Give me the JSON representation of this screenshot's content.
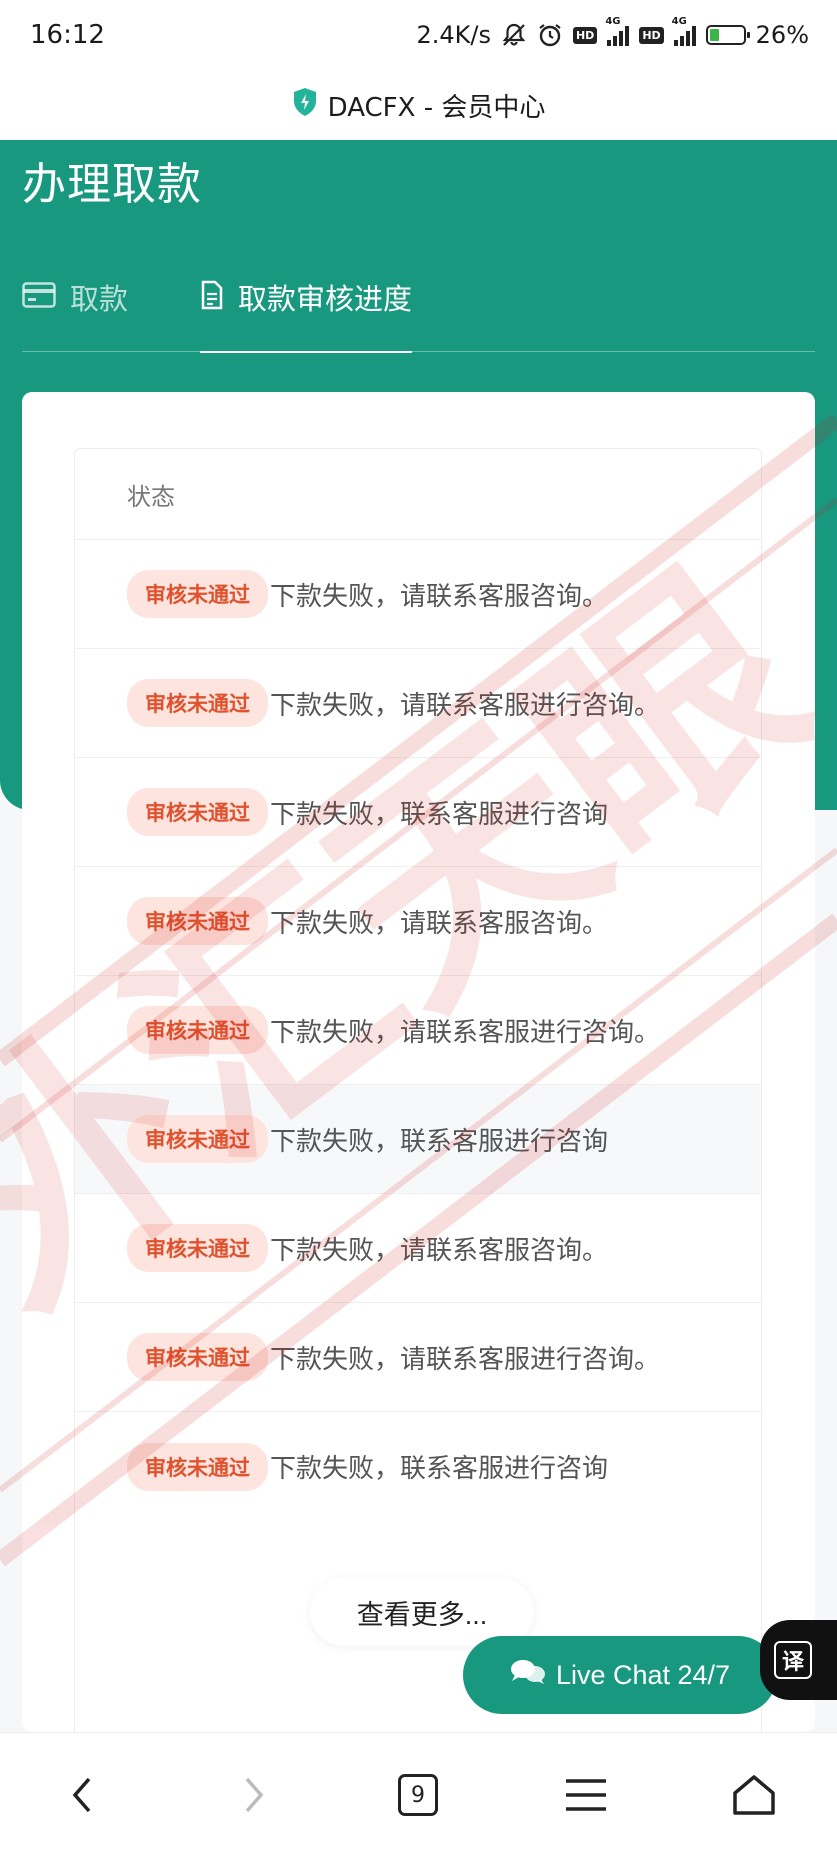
{
  "status_bar": {
    "time": "16:12",
    "net_speed": "2.4K/s",
    "hd": "HD",
    "network": "4G",
    "battery": "26%"
  },
  "url_bar": {
    "site_title": "DACFX - 会员中心"
  },
  "page": {
    "title": "办理取款"
  },
  "tabs": [
    {
      "label": "取款"
    },
    {
      "label": "取款审核进度"
    }
  ],
  "list": {
    "header": "状态",
    "rows": [
      {
        "status": "审核未通过",
        "message": "下款失败，请联系客服咨询。"
      },
      {
        "status": "审核未通过",
        "message": "下款失败，请联系客服进行咨询。"
      },
      {
        "status": "审核未通过",
        "message": "下款失败，联系客服进行咨询"
      },
      {
        "status": "审核未通过",
        "message": "下款失败，请联系客服咨询。"
      },
      {
        "status": "审核未通过",
        "message": "下款失败，请联系客服进行咨询。"
      },
      {
        "status": "审核未通过",
        "message": "下款失败，联系客服进行咨询"
      },
      {
        "status": "审核未通过",
        "message": "下款失败，请联系客服咨询。"
      },
      {
        "status": "审核未通过",
        "message": "下款失败，请联系客服进行咨询。"
      },
      {
        "status": "审核未通过",
        "message": "下款失败，联系客服进行咨询"
      }
    ]
  },
  "load_more": "查看更多...",
  "live_chat": "Live Chat 24/7",
  "translate": "译",
  "bottom_nav": {
    "tab_count": "9"
  },
  "colors": {
    "brand_green": "#17987f",
    "badge_bg": "#fde4de",
    "badge_text": "#e0522e"
  },
  "watermark_text": "外汇天眼"
}
